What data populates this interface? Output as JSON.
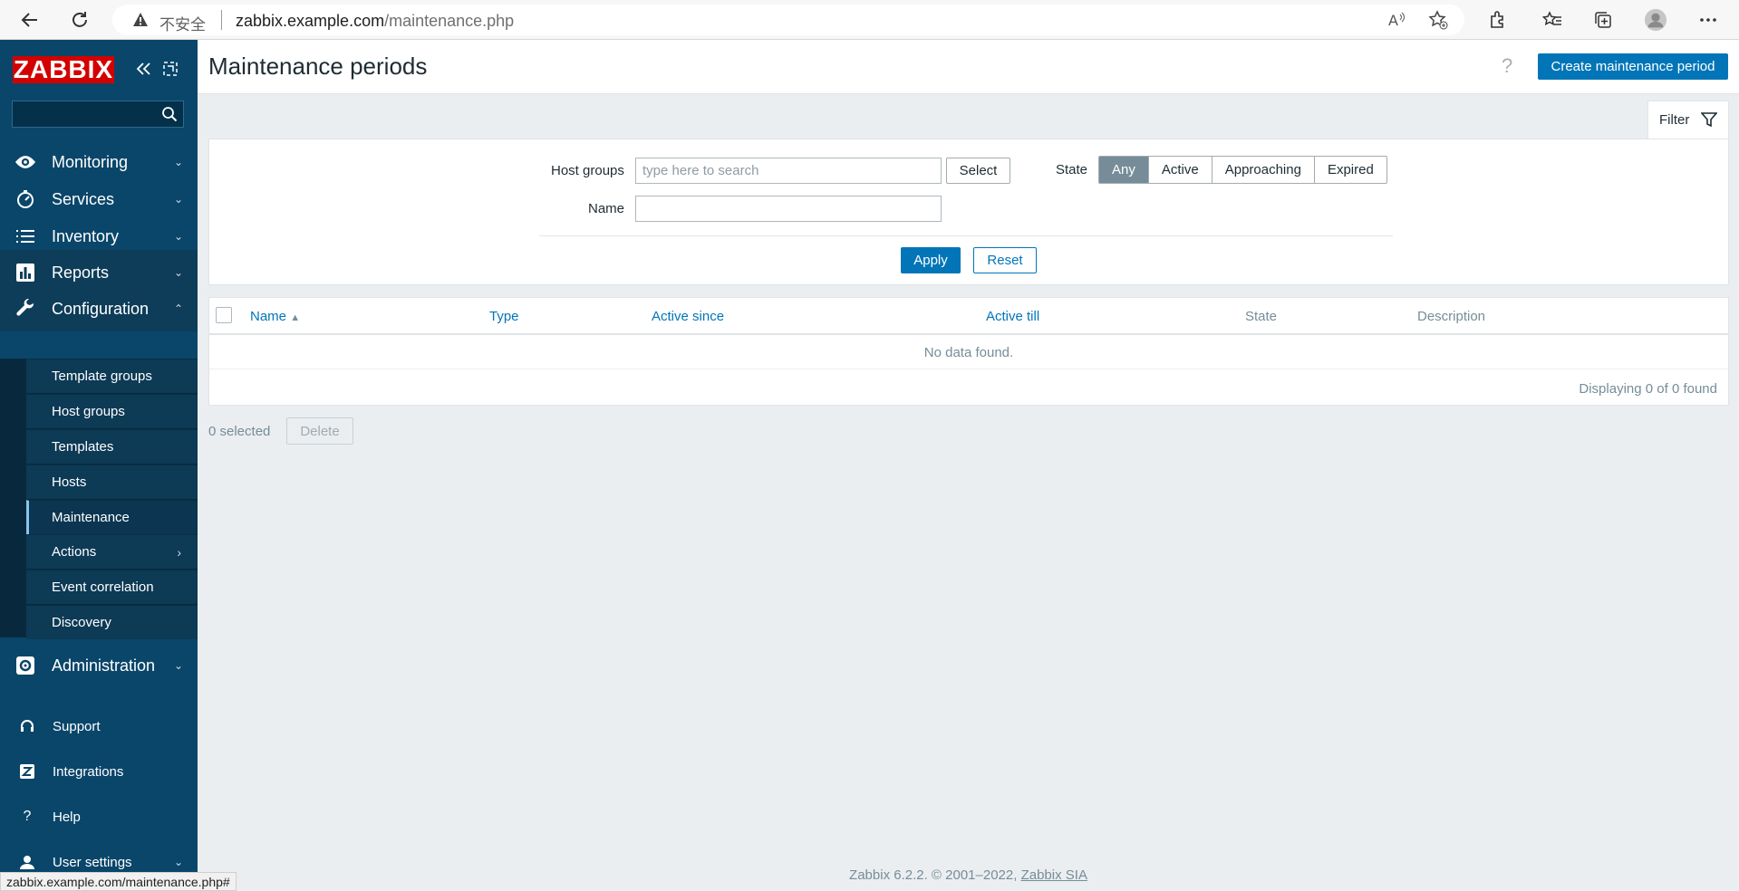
{
  "browser": {
    "insecure_label": "不安全",
    "url_domain": "zabbix.example.com",
    "url_path": "/maintenance.php",
    "status_url": "zabbix.example.com/maintenance.php#"
  },
  "sidebar": {
    "logo": "ZABBIX",
    "search_placeholder": "",
    "menu": [
      {
        "label": "Monitoring",
        "icon": "eye-icon"
      },
      {
        "label": "Services",
        "icon": "stopwatch-icon"
      },
      {
        "label": "Inventory",
        "icon": "list-icon"
      },
      {
        "label": "Reports",
        "icon": "bar-chart-icon"
      },
      {
        "label": "Configuration",
        "icon": "wrench-icon"
      },
      {
        "label": "Administration",
        "icon": "cog-icon"
      }
    ],
    "config_submenu": [
      "Template groups",
      "Host groups",
      "Templates",
      "Hosts",
      "Maintenance",
      "Actions",
      "Event correlation",
      "Discovery"
    ],
    "lower": [
      {
        "label": "Support",
        "icon": "headset-icon"
      },
      {
        "label": "Integrations",
        "icon": "z-icon"
      },
      {
        "label": "Help",
        "icon": "question-icon"
      },
      {
        "label": "User settings",
        "icon": "user-icon"
      }
    ]
  },
  "header": {
    "title": "Maintenance periods",
    "help": "?",
    "create_button": "Create maintenance period"
  },
  "filter": {
    "tab_label": "Filter",
    "host_groups_label": "Host groups",
    "host_groups_placeholder": "type here to search",
    "select_button": "Select",
    "name_label": "Name",
    "name_value": "",
    "state_label": "State",
    "state_options": [
      "Any",
      "Active",
      "Approaching",
      "Expired"
    ],
    "state_selected": "Any",
    "apply_button": "Apply",
    "reset_button": "Reset"
  },
  "table": {
    "columns": [
      "Name",
      "Type",
      "Active since",
      "Active till",
      "State",
      "Description"
    ],
    "sort_column": "Name",
    "sort_indicator": "▲",
    "empty_text": "No data found.",
    "paging": "Displaying 0 of 0 found"
  },
  "actions": {
    "selected_text": "0 selected",
    "delete_button": "Delete"
  },
  "footer": {
    "text": "Zabbix 6.2.2. © 2001–2022, ",
    "link": "Zabbix SIA"
  },
  "colors": {
    "sidebar_bg": "#0a466a",
    "accent_blue": "#0275b8",
    "logo_red": "#d40000",
    "page_bg": "#ebeef0"
  }
}
